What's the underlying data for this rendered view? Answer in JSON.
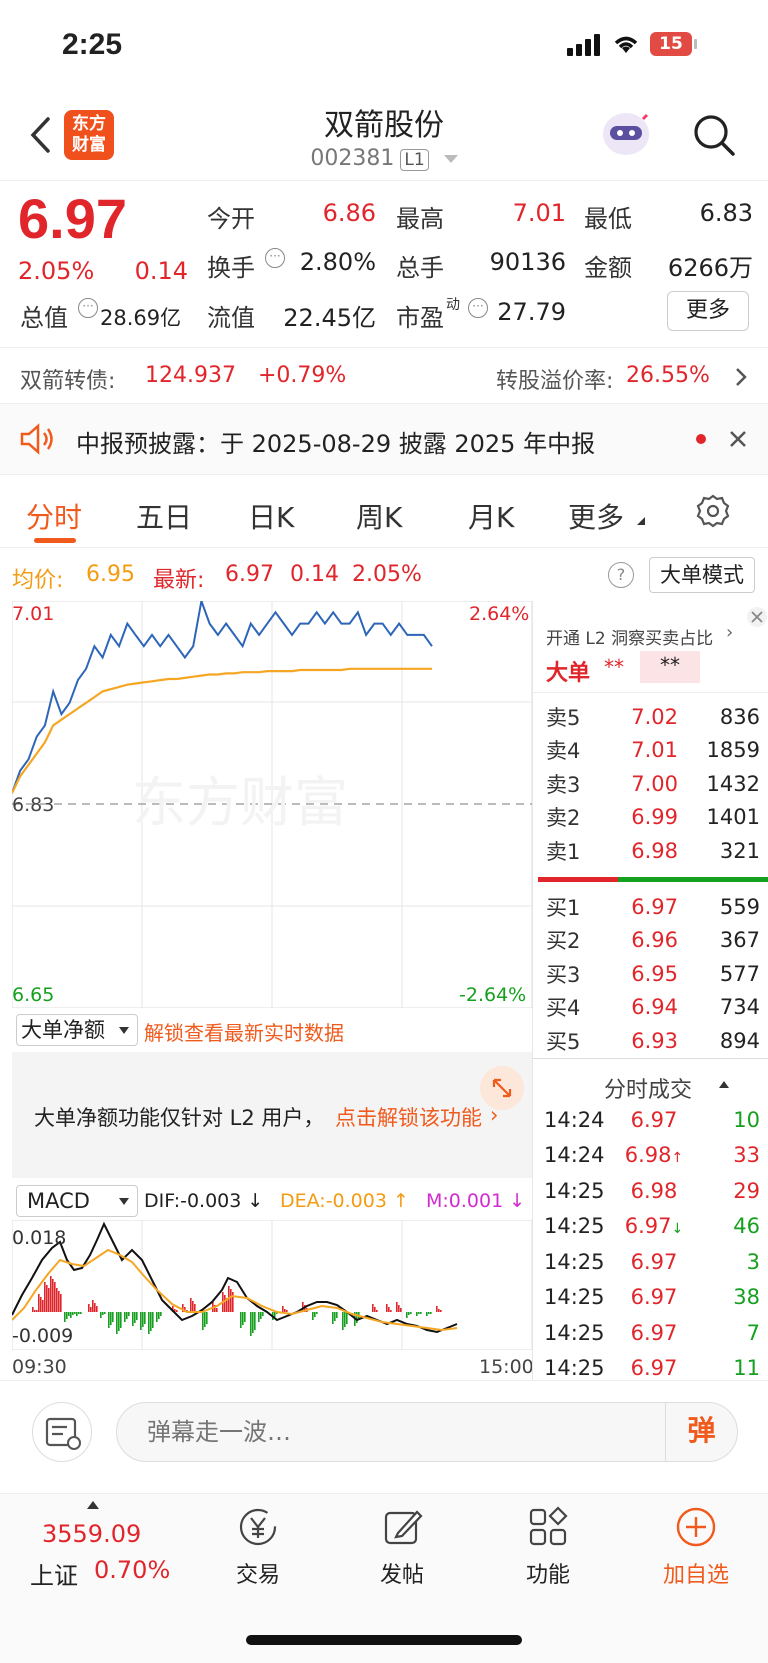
{
  "status": {
    "time": "2:25",
    "battery": "15"
  },
  "nav": {
    "stock_name": "双箭股份",
    "stock_code": "002381",
    "level_badge": "L1",
    "logo_text": "东方财富"
  },
  "quote": {
    "price": "6.97",
    "change_pct": "2.05%",
    "change": "0.14",
    "open_label": "今开",
    "open": "6.86",
    "high_label": "最高",
    "high": "7.01",
    "low_label": "最低",
    "low": "6.83",
    "turnover_label": "换手",
    "turnover": "2.80%",
    "volume_label": "总手",
    "volume": "90136",
    "amount_label": "金额",
    "amount": "6266万",
    "mktcap_label": "总值",
    "mktcap": "28.69亿",
    "float_label": "流值",
    "float_cap": "22.45亿",
    "pe_label": "市盈",
    "pe_sup": "动",
    "pe": "27.79",
    "more_button": "更多"
  },
  "bond": {
    "label": "双箭转债:",
    "price": "124.937",
    "pct": "+0.79%",
    "premium_label": "转股溢价率:",
    "premium": "26.55%"
  },
  "notice": {
    "text": "中报预披露：于 2025-08-29 披露 2025 年中报"
  },
  "tabs": [
    "分时",
    "五日",
    "日K",
    "周K",
    "月K",
    "更多"
  ],
  "chart_header": {
    "avg_label": "均价:",
    "avg": "6.95",
    "latest_label": "最新:",
    "latest": "6.97",
    "chg": "0.14",
    "pct": "2.05%",
    "mode_button": "大单模式"
  },
  "chart_data": {
    "type": "line",
    "y_left_top": "7.01",
    "y_left_mid": "6.83",
    "y_left_bottom": "6.65",
    "y_right_top": "2.64%",
    "y_right_bottom": "-2.64%",
    "watermark": "东方财富",
    "series": [
      {
        "color": "#2d66b8",
        "values": [
          6.84,
          6.86,
          6.87,
          6.89,
          6.9,
          6.93,
          6.91,
          6.92,
          6.94,
          6.95,
          6.97,
          6.96,
          6.98,
          6.97,
          6.99,
          6.98,
          6.97,
          6.98,
          6.97,
          6.98,
          6.97,
          6.96,
          6.97,
          7.01,
          6.99,
          6.98,
          6.99,
          6.98,
          6.97,
          6.99,
          6.98,
          6.99,
          7.0,
          6.99,
          6.98,
          6.99,
          6.99,
          7.0,
          6.99,
          7.0,
          6.99,
          6.99,
          7.0,
          6.98,
          6.99,
          6.99,
          6.98,
          6.99,
          6.98,
          6.98,
          6.98,
          6.97
        ]
      },
      {
        "color": "#f5a623",
        "values": [
          6.84,
          6.855,
          6.865,
          6.875,
          6.885,
          6.9,
          6.905,
          6.91,
          6.915,
          6.92,
          6.925,
          6.93,
          6.932,
          6.934,
          6.936,
          6.937,
          6.938,
          6.939,
          6.94,
          6.941,
          6.941,
          6.942,
          6.943,
          6.944,
          6.945,
          6.945,
          6.946,
          6.946,
          6.947,
          6.947,
          6.947,
          6.948,
          6.948,
          6.948,
          6.948,
          6.949,
          6.949,
          6.949,
          6.949,
          6.949,
          6.949,
          6.95,
          6.95,
          6.95,
          6.95,
          6.95,
          6.95,
          6.95,
          6.95,
          6.95,
          6.95,
          6.95
        ]
      }
    ]
  },
  "orderbook": {
    "promo": "开通 L2 洞察买卖占比",
    "big_label": "大单",
    "masked": "**",
    "asks": [
      {
        "label": "卖5",
        "price": "7.02",
        "vol": "836"
      },
      {
        "label": "卖4",
        "price": "7.01",
        "vol": "1859"
      },
      {
        "label": "卖3",
        "price": "7.00",
        "vol": "1432"
      },
      {
        "label": "卖2",
        "price": "6.99",
        "vol": "1401"
      },
      {
        "label": "卖1",
        "price": "6.98",
        "vol": "321"
      }
    ],
    "bids": [
      {
        "label": "买1",
        "price": "6.97",
        "vol": "559"
      },
      {
        "label": "买2",
        "price": "6.96",
        "vol": "367"
      },
      {
        "label": "买3",
        "price": "6.95",
        "vol": "577"
      },
      {
        "label": "买4",
        "price": "6.94",
        "vol": "734"
      },
      {
        "label": "买5",
        "price": "6.93",
        "vol": "894"
      }
    ]
  },
  "trades": {
    "title": "分时成交",
    "rows": [
      {
        "time": "14:24",
        "price": "6.97",
        "arrow": "",
        "vol": "10",
        "color": "green"
      },
      {
        "time": "14:24",
        "price": "6.98",
        "arrow": "↑",
        "vol": "33",
        "color": "red"
      },
      {
        "time": "14:25",
        "price": "6.98",
        "arrow": "",
        "vol": "29",
        "color": "red"
      },
      {
        "time": "14:25",
        "price": "6.97",
        "arrow": "↓",
        "vol": "46",
        "color": "green"
      },
      {
        "time": "14:25",
        "price": "6.97",
        "arrow": "",
        "vol": "3",
        "color": "green"
      },
      {
        "time": "14:25",
        "price": "6.97",
        "arrow": "",
        "vol": "38",
        "color": "green"
      },
      {
        "time": "14:25",
        "price": "6.97",
        "arrow": "",
        "vol": "7",
        "color": "green"
      },
      {
        "time": "14:25",
        "price": "6.97",
        "arrow": "",
        "vol": "11",
        "color": "green"
      }
    ]
  },
  "bigorder": {
    "select": "大单净额",
    "unlock_link": "解锁查看最新实时数据",
    "message": "大单净额功能仅针对 L2 用户，",
    "message_link": "点击解锁该功能"
  },
  "macd": {
    "select": "MACD",
    "dif": "DIF:-0.003 ↓",
    "dea": "DEA:-0.003 ↑",
    "m": "M:0.001 ↓",
    "top": "0.018",
    "bottom": "-0.009",
    "time_start": "09:30",
    "time_end": "15:00"
  },
  "comment": {
    "placeholder": "弹幕走一波…",
    "danmu_btn": "弹"
  },
  "bottombar": {
    "index_value": "3559.09",
    "index_name": "上证",
    "index_pct": "0.70%",
    "items": [
      "交易",
      "发帖",
      "功能",
      "加自选"
    ]
  }
}
